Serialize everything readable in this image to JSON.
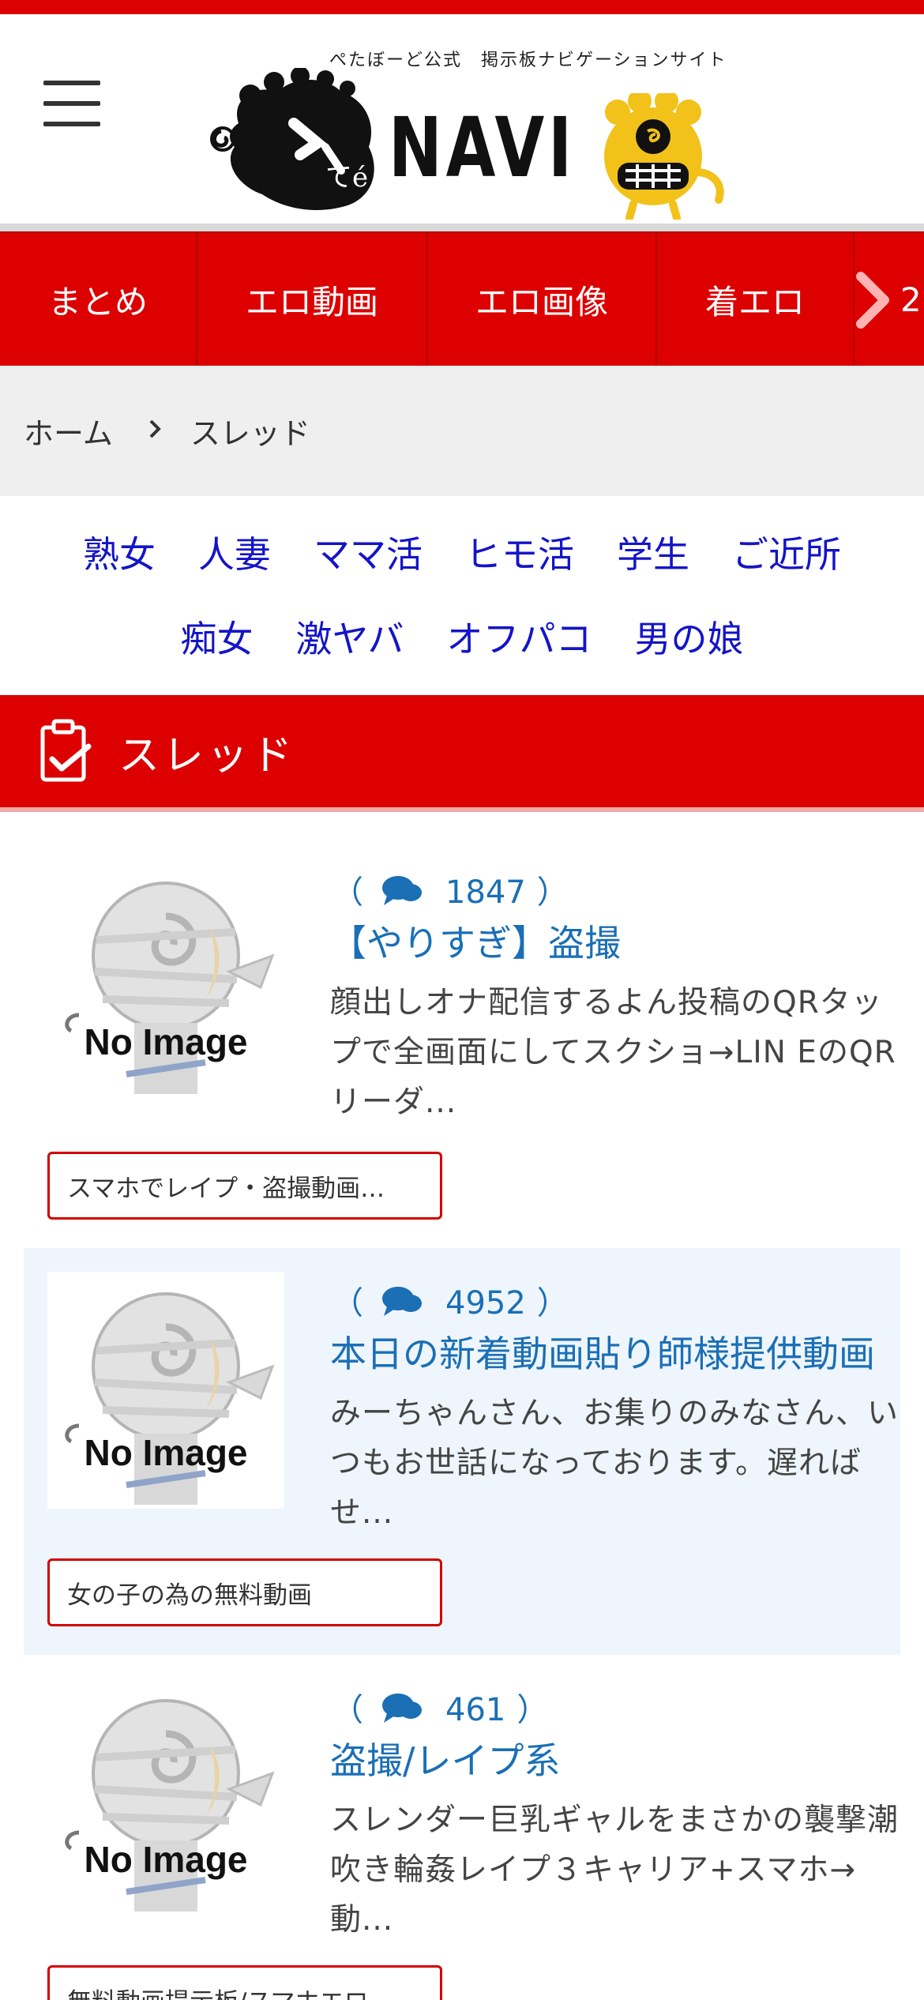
{
  "header": {
    "tagline": "ぺたぼーど公式　掲示板ナビゲーションサイト",
    "logo_text": "NAVI"
  },
  "nav": {
    "items": [
      {
        "label": "まとめ"
      },
      {
        "label": "エロ動画"
      },
      {
        "label": "エロ画像"
      },
      {
        "label": "着エロ"
      }
    ],
    "more_label": "2",
    "arrow_icon": "chevron-right-icon"
  },
  "breadcrumb": {
    "home": "ホーム",
    "current": "スレッド"
  },
  "tags": {
    "row1": [
      "熟女",
      "人妻",
      "ママ活",
      "ヒモ活",
      "学生",
      "ご近所"
    ],
    "row2": [
      "痴女",
      "激ヤバ",
      "オフパコ",
      "男の娘"
    ]
  },
  "section": {
    "title": "スレッド",
    "icon": "clipboard-check-icon"
  },
  "threads": [
    {
      "count_open": "（",
      "count": "1847",
      "count_close": "）",
      "title": "【やりすぎ】盗撮",
      "excerpt": "顔出しオナ配信するよん投稿のQRタップで全画面にしてスクショ→LIN EのQRリーダ...",
      "board": "スマホでレイプ・盗撮動画…",
      "no_image": "No Image"
    },
    {
      "count_open": "（",
      "count": "4952",
      "count_close": "）",
      "title": "本日の新着動画貼り師様提供動画",
      "excerpt": "みーちゃんさん、お集りのみなさん、いつもお世話になっております。遅ればせ...",
      "board": "女の子の為の無料動画",
      "no_image": "No Image"
    },
    {
      "count_open": "（",
      "count": "461",
      "count_close": "）",
      "title": "盗撮/レイプ系",
      "excerpt": "スレンダー巨乳ギャルをまさかの襲撃潮吹き輪姦レイプ３キャリア+スマホ→動...",
      "board": "無料動画提示板/スマホエロ…",
      "no_image": "No Image"
    }
  ],
  "colors": {
    "brand_red": "#dd0000",
    "link_blue": "#1a6fb5",
    "tag_blue": "#1414c8",
    "alt_row": "#eef5fc"
  }
}
